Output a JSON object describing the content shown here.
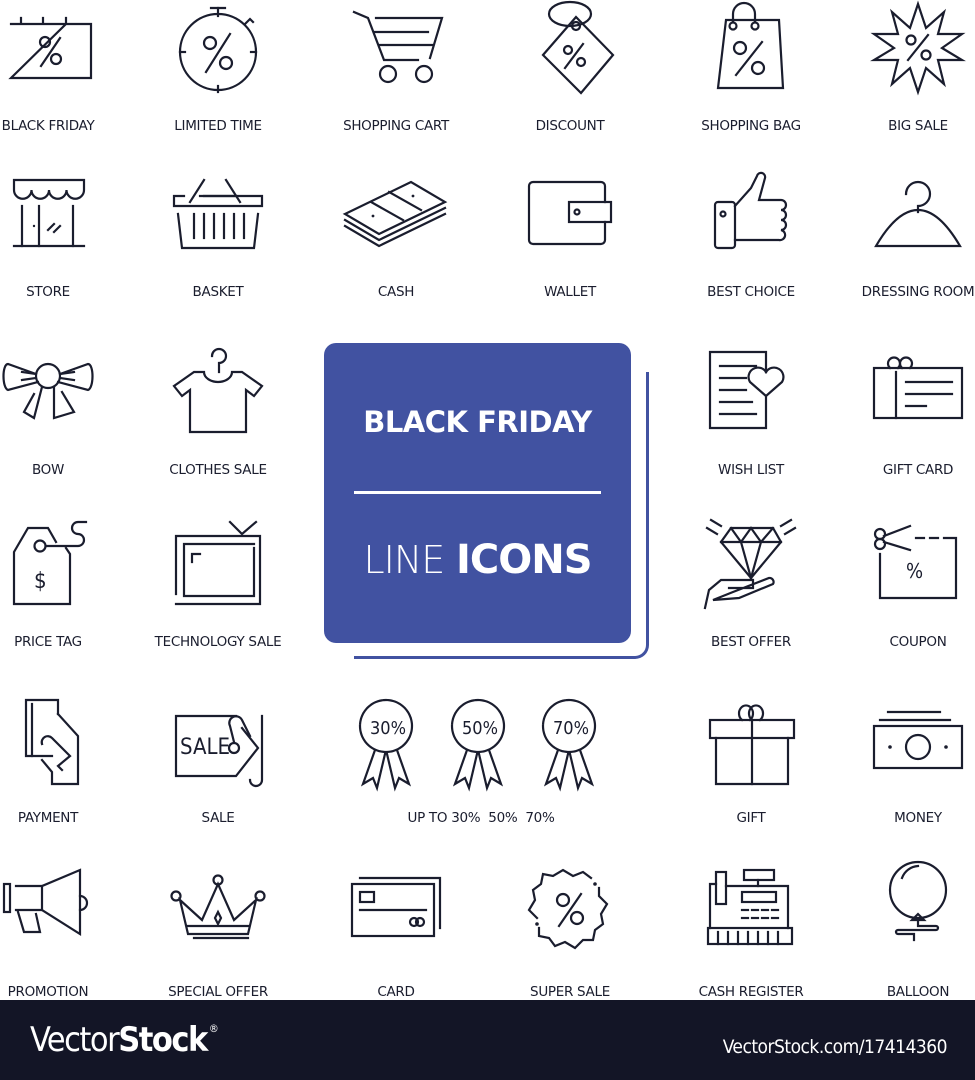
{
  "colors": {
    "ink": "#1a1d2e",
    "badge": "#4152a1",
    "footer": "#131526",
    "background": "#ffffff"
  },
  "badge": {
    "title": "BLACK FRIDAY",
    "subtitle_light": "LINE",
    "subtitle_bold": "ICONS"
  },
  "icons": [
    {
      "id": "black-friday",
      "icon": "calendar-percent-icon",
      "label": "BLACK FRIDAY"
    },
    {
      "id": "limited-time",
      "icon": "stopwatch-percent-icon",
      "label": "LIMITED TIME"
    },
    {
      "id": "shopping-cart",
      "icon": "shopping-cart-icon",
      "label": "SHOPPING CART"
    },
    {
      "id": "discount",
      "icon": "discount-tag-icon",
      "label": "DISCOUNT"
    },
    {
      "id": "shopping-bag",
      "icon": "shopping-bag-icon",
      "label": "SHOPPING BAG"
    },
    {
      "id": "big-sale",
      "icon": "starburst-percent-icon",
      "label": "BIG SALE"
    },
    {
      "id": "store",
      "icon": "storefront-icon",
      "label": "STORE"
    },
    {
      "id": "basket",
      "icon": "basket-icon",
      "label": "BASKET"
    },
    {
      "id": "cash",
      "icon": "cash-stack-icon",
      "label": "CASH"
    },
    {
      "id": "wallet",
      "icon": "wallet-icon",
      "label": "WALLET"
    },
    {
      "id": "best-choice",
      "icon": "thumbs-up-icon",
      "label": "BEST CHOICE"
    },
    {
      "id": "dressing-room",
      "icon": "hanger-icon",
      "label": "DRESSING ROOM"
    },
    {
      "id": "bow",
      "icon": "bow-icon",
      "label": "BOW"
    },
    {
      "id": "clothes-sale",
      "icon": "shirt-hanger-icon",
      "label": "CLOTHES SALE"
    },
    {
      "id": "wish-list",
      "icon": "wish-list-icon",
      "label": "WISH LIST"
    },
    {
      "id": "gift-card",
      "icon": "gift-card-icon",
      "label": "GIFT CARD"
    },
    {
      "id": "price-tag",
      "icon": "price-tag-icon",
      "label": "PRICE TAG"
    },
    {
      "id": "technology-sale",
      "icon": "tv-icon",
      "label": "TECHNOLOGY SALE"
    },
    {
      "id": "best-offer",
      "icon": "diamond-hand-icon",
      "label": "BEST OFFER"
    },
    {
      "id": "coupon",
      "icon": "coupon-scissors-icon",
      "label": "COUPON"
    },
    {
      "id": "payment",
      "icon": "card-hand-icon",
      "label": "PAYMENT"
    },
    {
      "id": "sale",
      "icon": "sale-tag-icon",
      "label": "SALE"
    },
    {
      "id": "up-to",
      "icon": "award-ribbons-icon",
      "label": "UP TO 30%  50%  70%",
      "ribbons": [
        "30%",
        "50%",
        "70%"
      ]
    },
    {
      "id": "gift",
      "icon": "gift-box-icon",
      "label": "GIFT"
    },
    {
      "id": "money",
      "icon": "banknote-icon",
      "label": "MONEY"
    },
    {
      "id": "promotion",
      "icon": "megaphone-icon",
      "label": "PROMOTION"
    },
    {
      "id": "special-offer",
      "icon": "crown-icon",
      "label": "SPECIAL OFFER"
    },
    {
      "id": "card",
      "icon": "credit-card-icon",
      "label": "CARD"
    },
    {
      "id": "super-sale",
      "icon": "seal-percent-icon",
      "label": "SUPER SALE"
    },
    {
      "id": "cash-register",
      "icon": "cash-register-icon",
      "label": "CASH REGISTER"
    },
    {
      "id": "balloon",
      "icon": "balloon-icon",
      "label": "BALLOON"
    }
  ],
  "sale_text": "SALE",
  "footer": {
    "brand_light": "Vector",
    "brand_bold": "Stock",
    "brand_mark": "®",
    "reference": "VectorStock.com/17414360"
  }
}
